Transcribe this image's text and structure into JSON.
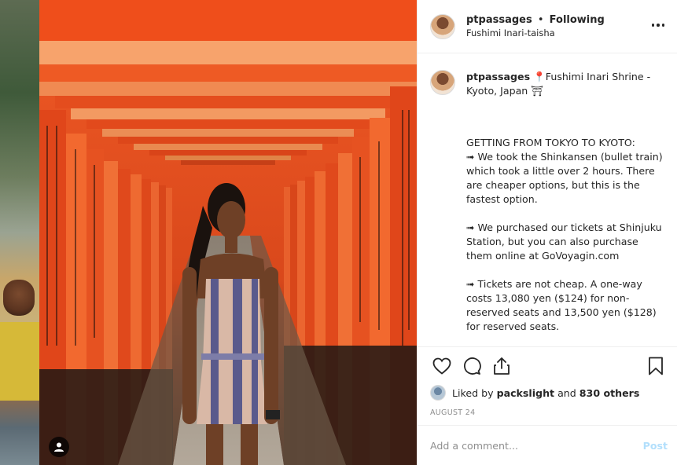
{
  "post": {
    "username": "ptpassages",
    "separator": "•",
    "follow_status": "Following",
    "location": "Fushimi Inari-taisha"
  },
  "caption": {
    "username": "ptpassages",
    "first_line": "📍Fushimi Inari Shrine - Kyoto, Japan ⛩",
    "paragraphs": [
      "GETTING FROM TOKYO TO KYOTO:\n➟ We took the Shinkansen (bullet train) which took a little over 2 hours. There are cheaper options, but this is the fastest option.",
      "➟ We purchased our tickets at Shinjuku Station, but you can also purchase them online at GoVoyagin.com",
      "➟ Tickets are not cheap. A one-way costs 13,080 yen ($124) for non-reserved seats and 13,500 yen ($128) for reserved seats."
    ]
  },
  "likes": {
    "prefix": "Liked by",
    "user": "packslight",
    "connector": "and",
    "others": "830 others"
  },
  "date": "AUGUST 24",
  "comment": {
    "placeholder": "Add a comment...",
    "post_label": "Post"
  },
  "colors": {
    "torii_orange": "#f0541f",
    "link_disabled": "#b2dffc",
    "text": "#262626",
    "muted": "#8e8e8e"
  },
  "icons": [
    "heart-icon",
    "comment-icon",
    "share-icon",
    "bookmark-icon",
    "more-options-icon",
    "user-tag-icon"
  ]
}
